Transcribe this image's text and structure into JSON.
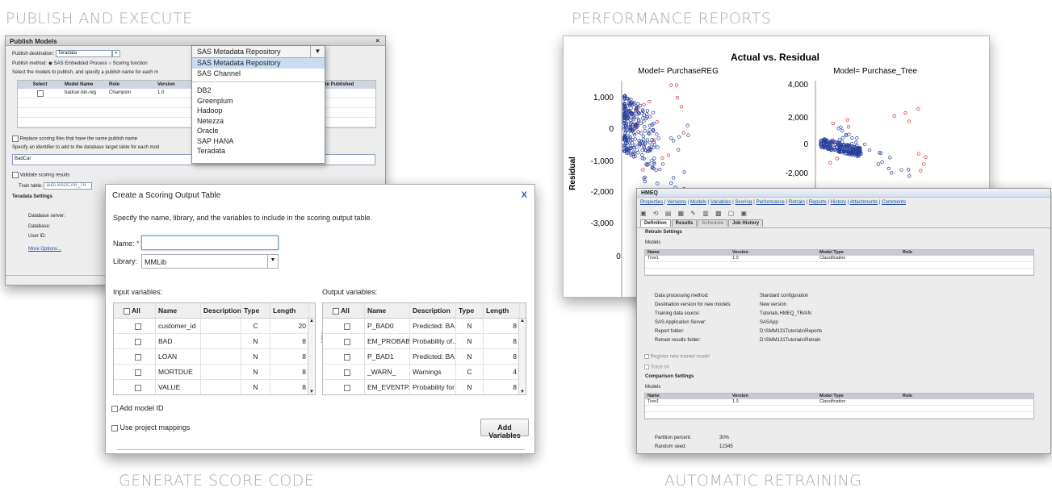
{
  "sections": {
    "publish": "PUBLISH AND EXECUTE",
    "performance": "PERFORMANCE REPORTS",
    "generate": "GENERATE SCORE CODE",
    "retraining": "AUTOMATIC RETRAINING"
  },
  "publish": {
    "title": "Publish Models",
    "close": "×",
    "destination_label": "Publish destination:",
    "destination_value": "Teradata",
    "method_label": "Publish method:",
    "method_opt1": "SAS Embedded Process",
    "method_opt2": "Scoring function",
    "select_text": "Select the models to publish, and specify a publish name for each m",
    "cols": [
      "Select",
      "Model Name",
      "Role",
      "Version",
      "Date Published"
    ],
    "rows": [
      [
        "",
        "badcar-bin-reg",
        "Champion",
        "1.0",
        ""
      ]
    ],
    "replace_label": "Replace scoring files that have the same publish name",
    "identifier_text": "Specify an identifier to add to the database target table for each mod",
    "identifier_value": "BadCar",
    "validate_label": "Validate scoring results",
    "train_label": "Train table:",
    "train_value": "auto.BADCAR_TR",
    "settings_title": "Teradata Settings",
    "server_label": "Database server:",
    "db_label": "Database:",
    "user_label": "User ID:",
    "more": "More Options..."
  },
  "dropdown": {
    "current": "SAS Metadata Repository",
    "items_top": [
      "SAS Metadata Repository",
      "SAS Channel"
    ],
    "items": [
      "DB2",
      "Greenplum",
      "Hadoop",
      "Netezza",
      "Oracle",
      "SAP HANA",
      "Teradata"
    ]
  },
  "scoring": {
    "title": "Create a Scoring Output Table",
    "close": "X",
    "instructions": "Specify the name, library, and the variables to include in the scoring output table.",
    "name_label": "Name:",
    "required": "*",
    "library_label": "Library:",
    "library_value": "MMLib",
    "input_label": "Input variables:",
    "output_label": "Output variables:",
    "cols": [
      "All",
      "Name",
      "Description",
      "Type",
      "Length"
    ],
    "input_rows": [
      [
        "customer_id",
        "",
        "C",
        "20"
      ],
      [
        "BAD",
        "",
        "N",
        "8"
      ],
      [
        "LOAN",
        "",
        "N",
        "8"
      ],
      [
        "MORTDUE",
        "",
        "N",
        "8"
      ],
      [
        "VALUE",
        "",
        "N",
        "8"
      ]
    ],
    "output_rows": [
      [
        "P_BAD0",
        "Predicted: BA...",
        "N",
        "8"
      ],
      [
        "EM_PROBABI...",
        "Probability of...",
        "N",
        "8"
      ],
      [
        "P_BAD1",
        "Predicted: BA...",
        "N",
        "8"
      ],
      [
        "_WARN_",
        "Warnings",
        "C",
        "4"
      ],
      [
        "EM_EVENTP...",
        "Probability for ...",
        "N",
        "8"
      ]
    ],
    "add_model_id": "Add model ID",
    "use_mappings": "Use project mappings",
    "add_button": "Add Variables"
  },
  "chart_data": [
    {
      "type": "scatter",
      "title": "Actual vs. Residual",
      "subtitle": "Model= PurchaseREG",
      "ylabel": "Residual",
      "yticks": [
        "1,000",
        "0",
        "-1,000",
        "-2,000",
        "-3,000"
      ],
      "xticks": [
        "0"
      ],
      "series": []
    },
    {
      "type": "scatter",
      "subtitle": "Model= Purchase_Tree",
      "yticks": [
        "4,000",
        "2,000",
        "0",
        "-2,000"
      ],
      "series": []
    }
  ],
  "hmeq": {
    "title": "HMEQ",
    "links": [
      "Properties",
      "Versions",
      "Models",
      "Variables",
      "Scoring",
      "Performance",
      "Retrain",
      "Reports",
      "History",
      "Attachments",
      "Comments"
    ],
    "tabs": [
      "Definition",
      "Results",
      "Schedule",
      "Job History"
    ],
    "retrain_title": "Retrain Settings",
    "models_label": "Models",
    "cols": [
      "Name",
      "Version",
      "Model Type",
      "Role"
    ],
    "rows1": [
      [
        "Tree1",
        "1.0",
        "Classification",
        ""
      ]
    ],
    "kv": [
      [
        "Data processing method:",
        "Standard configuration"
      ],
      [
        "Destination version for new models:",
        "New version"
      ],
      [
        "Training data source:",
        "Tutorials.HMEQ_TRAIN"
      ],
      [
        "SAS Application Server:",
        "SASApp"
      ],
      [
        "Report folder:",
        "D:\\SMM131Tutorials\\Reports"
      ],
      [
        "Retrain results folder:",
        "D:\\SMM131Tutorials\\Retrain"
      ]
    ],
    "register": "Register new trained model",
    "trace": "Trace on",
    "comparison_title": "Comparison Settings",
    "models_label2": "Models",
    "rows2": [
      [
        "Tree1",
        "1.0",
        "Classification",
        ""
      ]
    ],
    "partition_label": "Partition percent:",
    "partition_value": "30%",
    "seed_label": "Random seed:",
    "seed_value": "12345"
  }
}
